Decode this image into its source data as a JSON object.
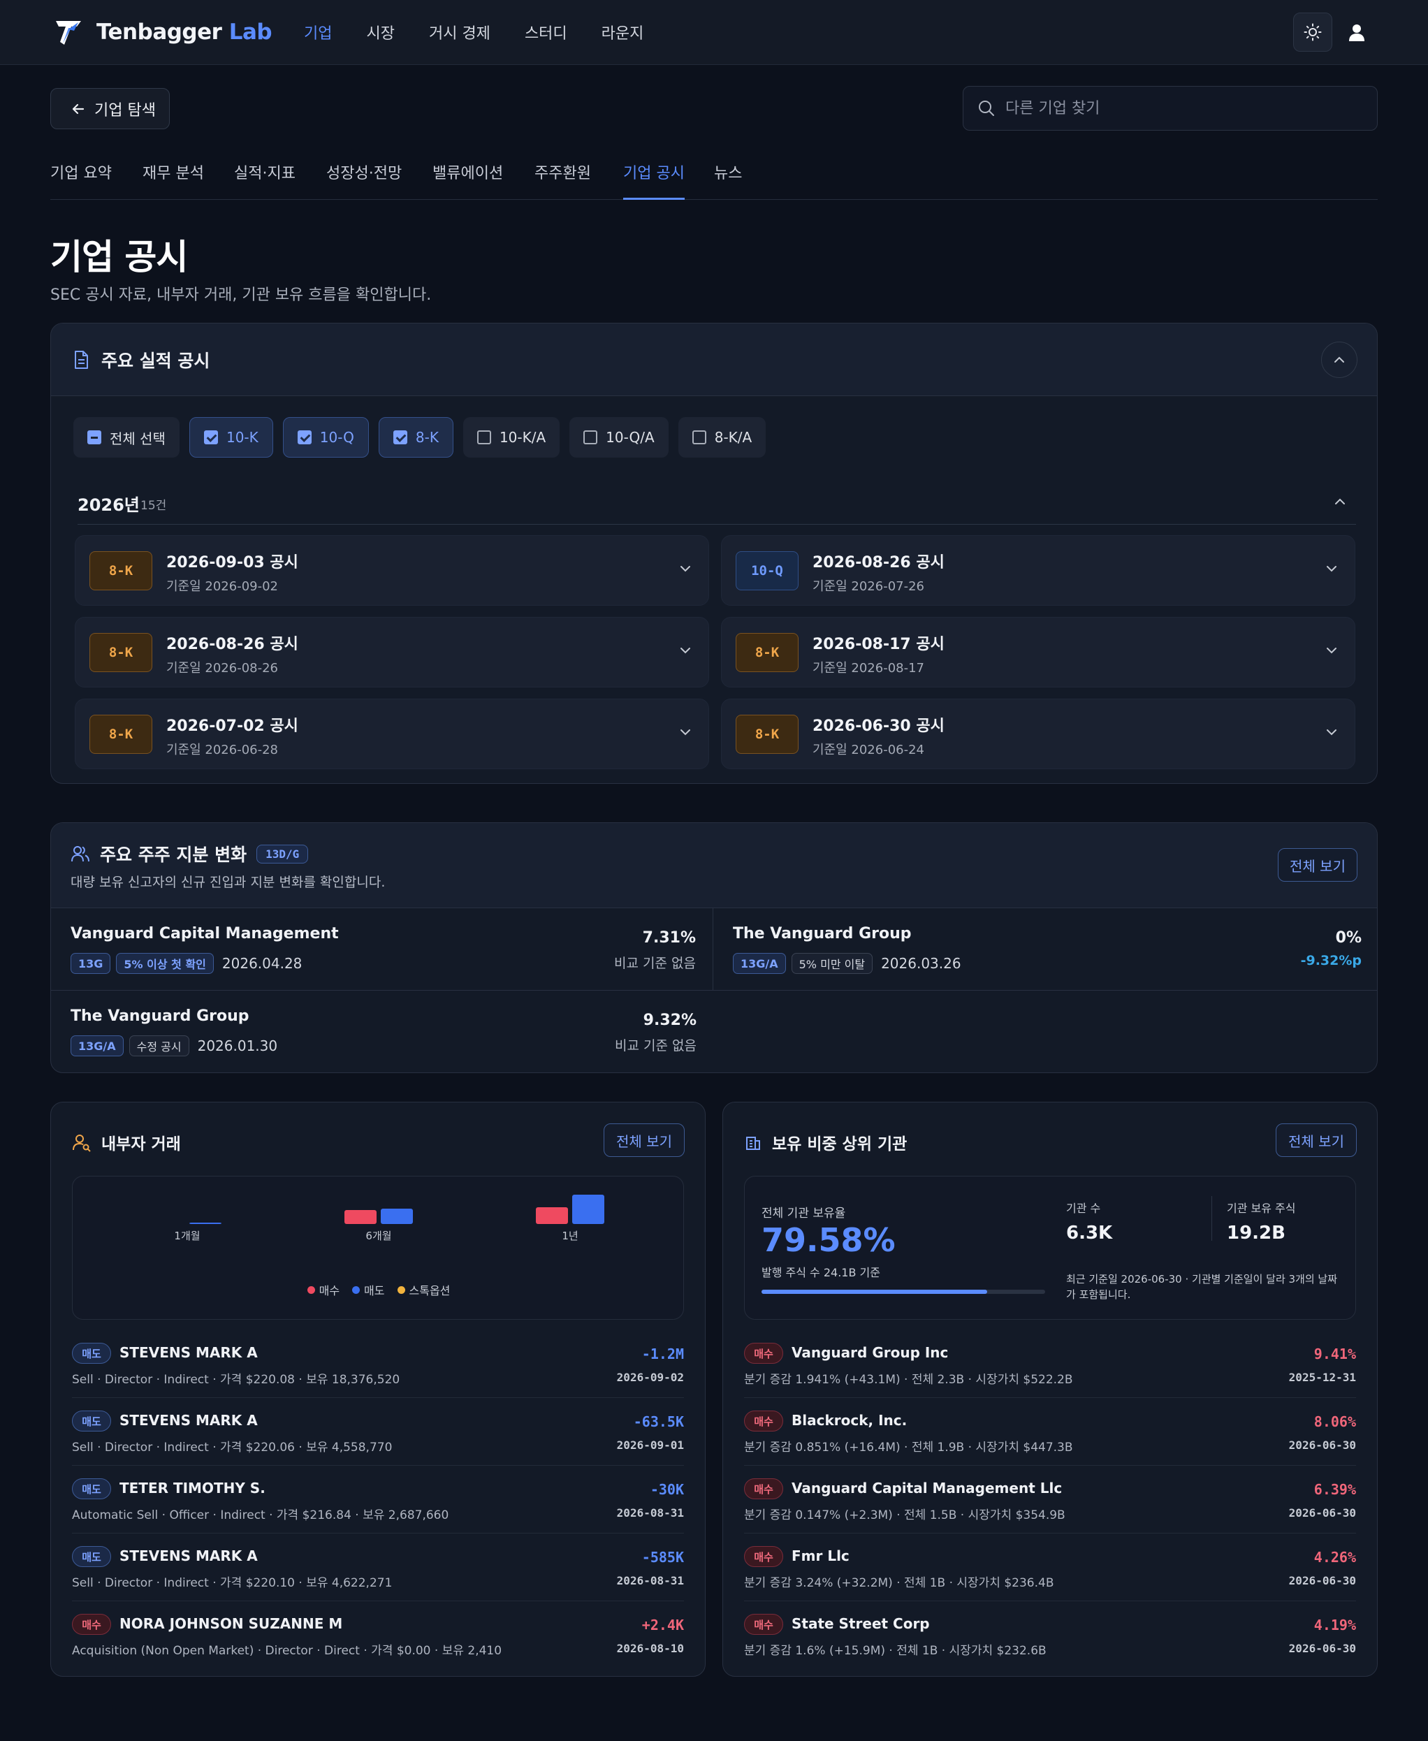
{
  "brand": {
    "name_main": "Tenbagger",
    "name_accent": "Lab"
  },
  "nav": {
    "items": [
      {
        "label": "기업",
        "active": true
      },
      {
        "label": "시장"
      },
      {
        "label": "거시 경제"
      },
      {
        "label": "스터디"
      },
      {
        "label": "라운지"
      }
    ]
  },
  "header": {
    "back_label": "기업 탐색",
    "search_placeholder": "다른 기업 찾기"
  },
  "tabs": [
    "기업 요약",
    "재무 분석",
    "실적·지표",
    "성장성·전망",
    "밸류에이션",
    "주주환원",
    "기업 공시",
    "뉴스"
  ],
  "active_tab": "기업 공시",
  "page": {
    "title": "기업 공시",
    "subtitle": "SEC 공시 자료, 내부자 거래, 기관 보유 흐름을 확인합니다."
  },
  "filings": {
    "title": "주요 실적 공시",
    "filters": [
      {
        "label": "전체 선택",
        "state": "partial"
      },
      {
        "label": "10-K",
        "state": "checked"
      },
      {
        "label": "10-Q",
        "state": "checked"
      },
      {
        "label": "8-K",
        "state": "checked"
      },
      {
        "label": "10-K/A",
        "state": "unchecked"
      },
      {
        "label": "10-Q/A",
        "state": "unchecked"
      },
      {
        "label": "8-K/A",
        "state": "unchecked"
      }
    ],
    "year": "2026년",
    "year_count": "15건",
    "items": [
      {
        "type": "8-K",
        "title": "2026-09-03 공시",
        "base": "기준일 2026-09-02"
      },
      {
        "type": "10-Q",
        "title": "2026-08-26 공시",
        "base": "기준일 2026-07-26"
      },
      {
        "type": "8-K",
        "title": "2026-08-26 공시",
        "base": "기준일 2026-08-26"
      },
      {
        "type": "8-K",
        "title": "2026-08-17 공시",
        "base": "기준일 2026-08-17"
      },
      {
        "type": "8-K",
        "title": "2026-07-02 공시",
        "base": "기준일 2026-06-28"
      },
      {
        "type": "8-K",
        "title": "2026-06-30 공시",
        "base": "기준일 2026-06-24"
      }
    ]
  },
  "holders": {
    "title": "주요 주주 지분 변화",
    "badge": "13D/G",
    "subtitle": "대량 보유 신고자의 신규 진입과 지분 변화를 확인합니다.",
    "view_all": "전체 보기",
    "items": [
      {
        "name": "Vanguard Capital Management",
        "tags": [
          "13G",
          "5% 이상 첫 확인"
        ],
        "date": "2026.04.28",
        "pct": "7.31%",
        "compare": "비교 기준 없음"
      },
      {
        "name": "The Vanguard Group",
        "tags": [
          "13G/A",
          "5% 미만 이탈"
        ],
        "date": "2026.03.26",
        "pct": "0%",
        "compare": "-9.32%p"
      },
      {
        "name": "The Vanguard Group",
        "tags": [
          "13G/A",
          "수정 공시"
        ],
        "date": "2026.01.30",
        "pct": "9.32%",
        "compare": "비교 기준 없음"
      }
    ]
  },
  "insider": {
    "title": "내부자 거래",
    "view_all": "전체 보기",
    "chart_data": {
      "type": "bar",
      "categories": [
        "1개월",
        "6개월",
        "1년"
      ],
      "series": [
        {
          "name": "매수",
          "color": "#ef4a60",
          "values": [
            0,
            1.0,
            1.2
          ]
        },
        {
          "name": "매도",
          "color": "#3a6ff0",
          "values": [
            0.1,
            1.1,
            2.1
          ]
        },
        {
          "name": "스톡옵션",
          "color": "#f2b33d",
          "values": [
            0,
            0,
            0
          ]
        }
      ]
    },
    "rows": [
      {
        "side": "매도",
        "kind": "sell",
        "name": "STEVENS MARK A",
        "detail": "Sell · Director · Indirect · 가격 $220.08 · 보유 18,376,520",
        "amount": "-1.2M",
        "date": "2026-09-02"
      },
      {
        "side": "매도",
        "kind": "sell",
        "name": "STEVENS MARK A",
        "detail": "Sell · Director · Indirect · 가격 $220.06 · 보유 4,558,770",
        "amount": "-63.5K",
        "date": "2026-09-01"
      },
      {
        "side": "매도",
        "kind": "sell",
        "name": "TETER TIMOTHY S.",
        "detail": "Automatic Sell · Officer · Indirect · 가격 $216.84 · 보유 2,687,660",
        "amount": "-30K",
        "date": "2026-08-31"
      },
      {
        "side": "매도",
        "kind": "sell",
        "name": "STEVENS MARK A",
        "detail": "Sell · Director · Indirect · 가격 $220.10 · 보유 4,622,271",
        "amount": "-585K",
        "date": "2026-08-31"
      },
      {
        "side": "매수",
        "kind": "buy",
        "name": "NORA JOHNSON SUZANNE M",
        "detail": "Acquisition (Non Open Market) · Director · Direct · 가격 $0.00 · 보유 2,410",
        "amount": "+2.4K",
        "date": "2026-08-10"
      }
    ]
  },
  "institutions": {
    "title": "보유 비중 상위 기관",
    "view_all": "전체 보기",
    "total_label": "전체 기관 보유율",
    "total_value": "79.58%",
    "total_fraction": 0.7958,
    "shares_note": "발행 주식 수 24.1B 기준",
    "count_label": "기관 수",
    "count_value": "6.3K",
    "shares_label": "기관 보유 주식",
    "shares_value": "19.2B",
    "note": "최근 기준일 2026-06-30 · 기관별 기준일이 달라 3개의 날짜가 포함됩니다.",
    "rows": [
      {
        "side": "매수",
        "name": "Vanguard Group Inc",
        "detail": "분기 증감 1.941% (+43.1M) · 전체 2.3B · 시장가치 $522.2B",
        "pct": "9.41%",
        "date": "2025-12-31"
      },
      {
        "side": "매수",
        "name": "Blackrock, Inc.",
        "detail": "분기 증감 0.851% (+16.4M) · 전체 1.9B · 시장가치 $447.3B",
        "pct": "8.06%",
        "date": "2026-06-30"
      },
      {
        "side": "매수",
        "name": "Vanguard Capital Management Llc",
        "detail": "분기 증감 0.147% (+2.3M) · 전체 1.5B · 시장가치 $354.9B",
        "pct": "6.39%",
        "date": "2026-06-30"
      },
      {
        "side": "매수",
        "name": "Fmr Llc",
        "detail": "분기 증감 3.24% (+32.2M) · 전체 1B · 시장가치 $236.4B",
        "pct": "4.26%",
        "date": "2026-06-30"
      },
      {
        "side": "매수",
        "name": "State Street Corp",
        "detail": "분기 증감 1.6% (+15.9M) · 전체 1B · 시장가치 $232.6B",
        "pct": "4.19%",
        "date": "2026-06-30"
      }
    ]
  }
}
